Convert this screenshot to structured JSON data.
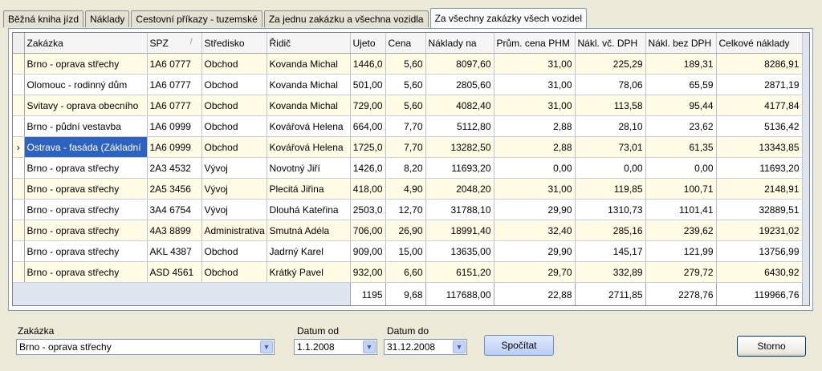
{
  "tabs": [
    {
      "label": "Běžná kniha jízd",
      "active": false
    },
    {
      "label": "Náklady",
      "active": false
    },
    {
      "label": "Cestovní příkazy - tuzemské",
      "active": false
    },
    {
      "label": "Za jednu zakázku a všechna vozidla",
      "active": false
    },
    {
      "label": "Za všechny zakázky všech vozidel",
      "active": true
    }
  ],
  "grid": {
    "columns": [
      "Zakázka",
      "SPZ",
      "Středisko",
      "Řidič",
      "Ujeto",
      "Cena",
      "Náklady na",
      "Prům. cena PHM",
      "Nákl. vč. DPH",
      "Nákl. bez DPH",
      "Celkové náklady"
    ],
    "sort_glyph": "/",
    "current_row_marker": "›",
    "rows": [
      [
        "Brno - oprava střechy",
        "1A6 0777",
        "Obchod",
        "Kovanda Michal",
        "1446,0",
        "5,60",
        "8097,60",
        "31,00",
        "225,29",
        "189,31",
        "8286,91"
      ],
      [
        "Olomouc - rodinný dům",
        "1A6 0777",
        "Obchod",
        "Kovanda Michal",
        "501,00",
        "5,60",
        "2805,60",
        "31,00",
        "78,06",
        "65,59",
        "2871,19"
      ],
      [
        "Svitavy - oprava obecního",
        "1A6 0777",
        "Obchod",
        "Kovanda Michal",
        "729,00",
        "5,60",
        "4082,40",
        "31,00",
        "113,58",
        "95,44",
        "4177,84"
      ],
      [
        "Brno - půdní vestavba",
        "1A6 0999",
        "Obchod",
        "Kovářová Helena",
        "664,00",
        "7,70",
        "5112,80",
        "2,88",
        "28,10",
        "23,62",
        "5136,42"
      ],
      [
        "Ostrava - fasáda (Základní",
        "1A6 0999",
        "Obchod",
        "Kovářová Helena",
        "1725,0",
        "7,70",
        "13282,50",
        "2,88",
        "73,01",
        "61,35",
        "13343,85"
      ],
      [
        "Brno - oprava střechy",
        "2A3 4532",
        "Vývoj",
        "Novotný Jiří",
        "1426,0",
        "8,20",
        "11693,20",
        "0,00",
        "0,00",
        "0,00",
        "11693,20"
      ],
      [
        "Brno - oprava střechy",
        "2A5 3456",
        "Vývoj",
        "Plecitá Jiřina",
        "418,00",
        "4,90",
        "2048,20",
        "31,00",
        "119,85",
        "100,71",
        "2148,91"
      ],
      [
        "Brno - oprava střechy",
        "3A4 6754",
        "Vývoj",
        "Dlouhá Kateřina",
        "2503,0",
        "12,70",
        "31788,10",
        "29,90",
        "1310,73",
        "1101,41",
        "32889,51"
      ],
      [
        "Brno - oprava střechy",
        "4A3 8899",
        "Administrativa",
        "Smutná Adéla",
        "706,00",
        "26,90",
        "18991,40",
        "32,40",
        "285,16",
        "239,62",
        "19231,02"
      ],
      [
        "Brno - oprava střechy",
        "AKL 4387",
        "Obchod",
        "Jadrný Karel",
        "909,00",
        "15,00",
        "13635,00",
        "29,90",
        "145,17",
        "121,99",
        "13756,99"
      ],
      [
        "Brno - oprava střechy",
        "ASD 4561",
        "Obchod",
        "Krátký Pavel",
        "932,00",
        "6,60",
        "6151,20",
        "29,70",
        "332,89",
        "279,72",
        "6430,92"
      ]
    ],
    "selected_row_index": 4,
    "totals": [
      "",
      "",
      "",
      "",
      "1195",
      "9,68",
      "117688,00",
      "22,88",
      "2711,85",
      "2278,76",
      "119966,76"
    ]
  },
  "filters": {
    "zakazka_label": "Zakázka",
    "zakazka_value": "Brno - oprava střechy",
    "datum_od_label": "Datum od",
    "datum_od_value": "1.1.2008",
    "datum_do_label": "Datum do",
    "datum_do_value": "31.12.2008"
  },
  "buttons": {
    "calculate": "Spočítat",
    "cancel": "Storno"
  },
  "icons": {
    "dropdown": "chevron-down-icon",
    "row_pointer": "row-pointer-icon"
  }
}
